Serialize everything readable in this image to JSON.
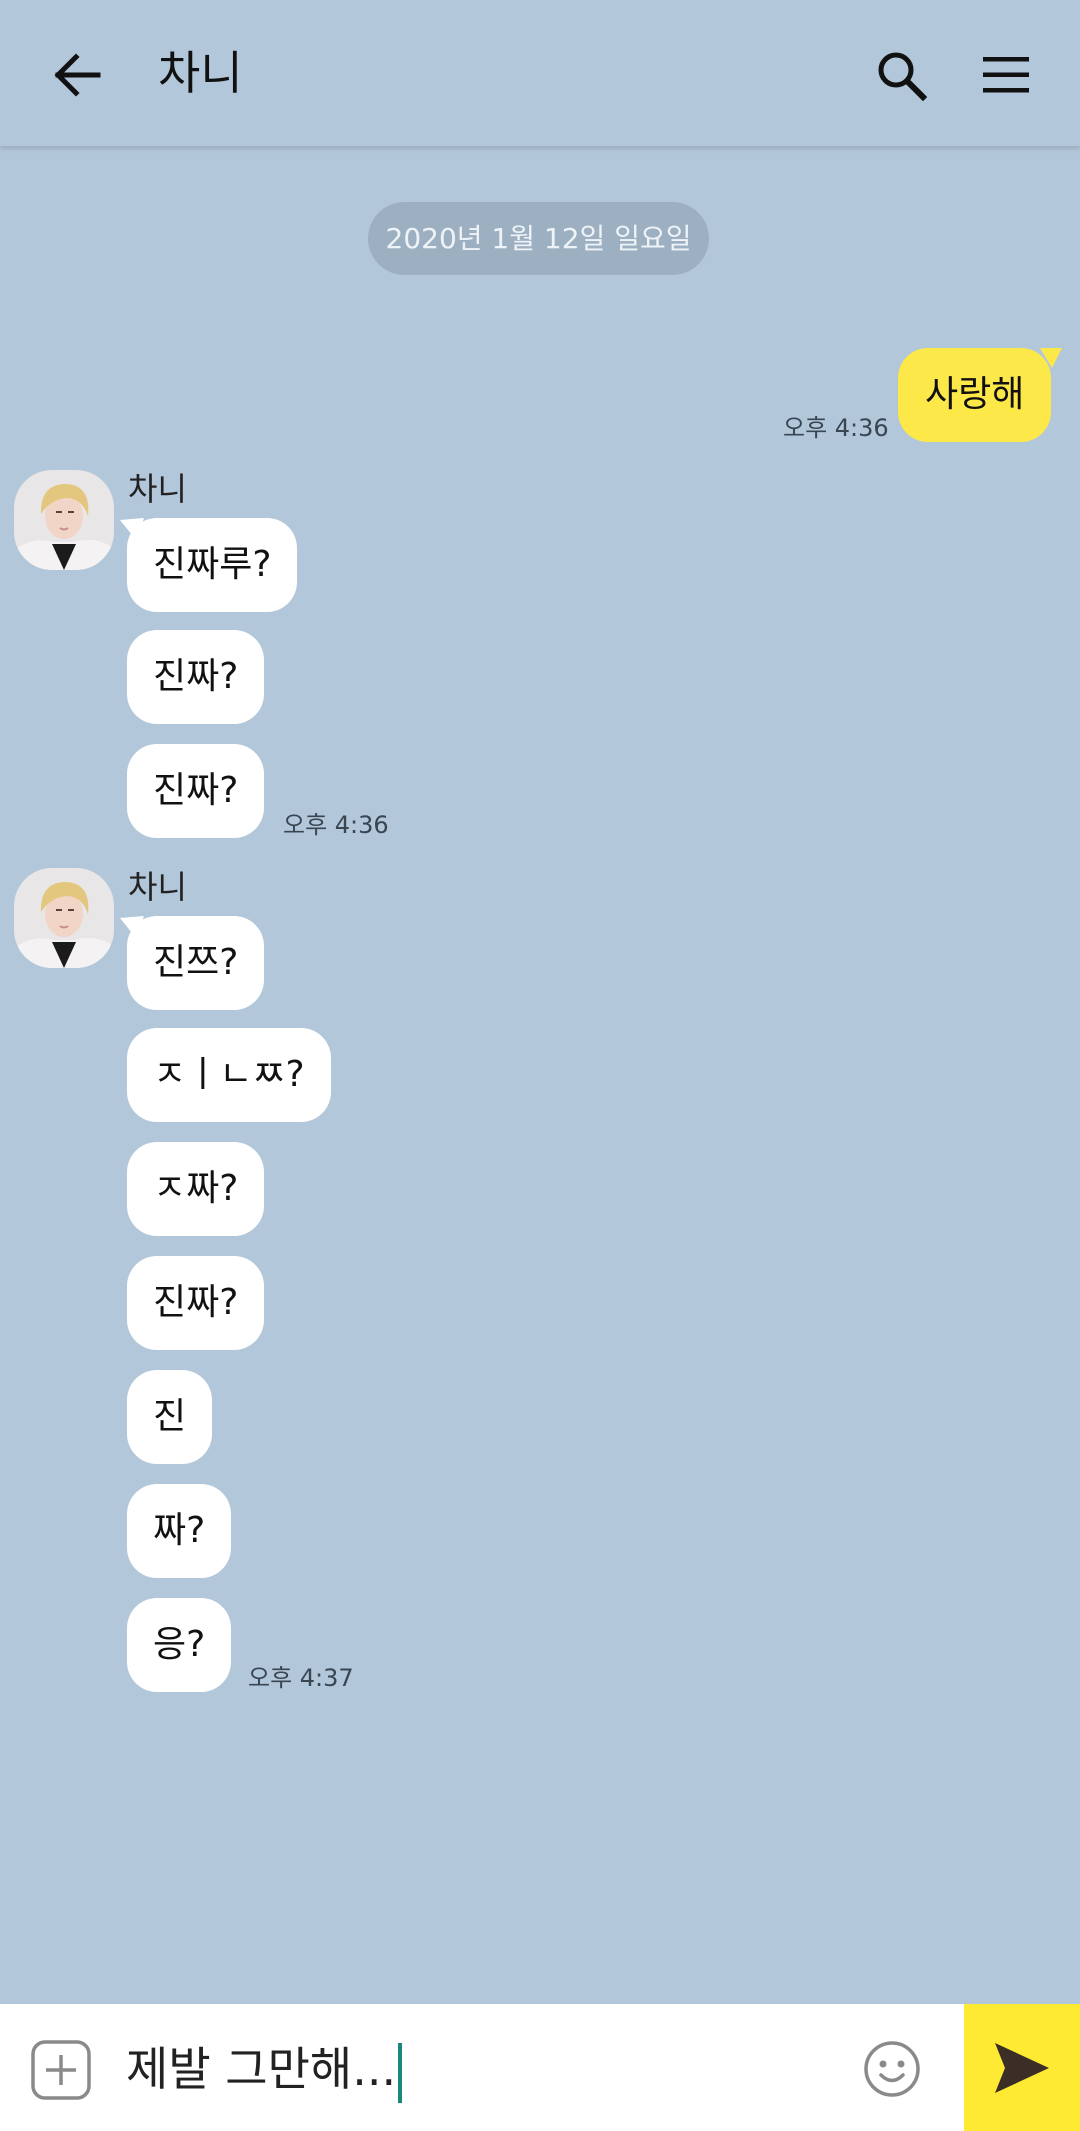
{
  "header": {
    "title": "차니",
    "back_icon": "arrow-left-icon",
    "search_icon": "search-icon",
    "menu_icon": "hamburger-menu-icon"
  },
  "chat": {
    "date_divider": "2020년 1월 12일 일요일",
    "outgoing": {
      "text": "사랑해",
      "time": "오후 4:36"
    },
    "groups": [
      {
        "sender": "차니",
        "messages": [
          "진짜루?",
          "진짜?",
          "진짜?"
        ],
        "time": "오후 4:36"
      },
      {
        "sender": "차니",
        "messages": [
          "진쯔?",
          "ㅈㅣㄴㅉ?",
          "ㅈ짜?",
          "진짜?",
          "진",
          "짜?",
          "응?"
        ],
        "time": "오후 4:37"
      }
    ]
  },
  "composer": {
    "value": "제발 그만해...",
    "add_icon": "plus-square-icon",
    "emoji_icon": "smiley-icon",
    "send_icon": "send-arrow-icon"
  },
  "colors": {
    "background": "#b2c7da",
    "my_bubble": "#fde84a",
    "their_bubble": "#ffffff",
    "send_button": "#fee933",
    "caret": "#19877a"
  }
}
